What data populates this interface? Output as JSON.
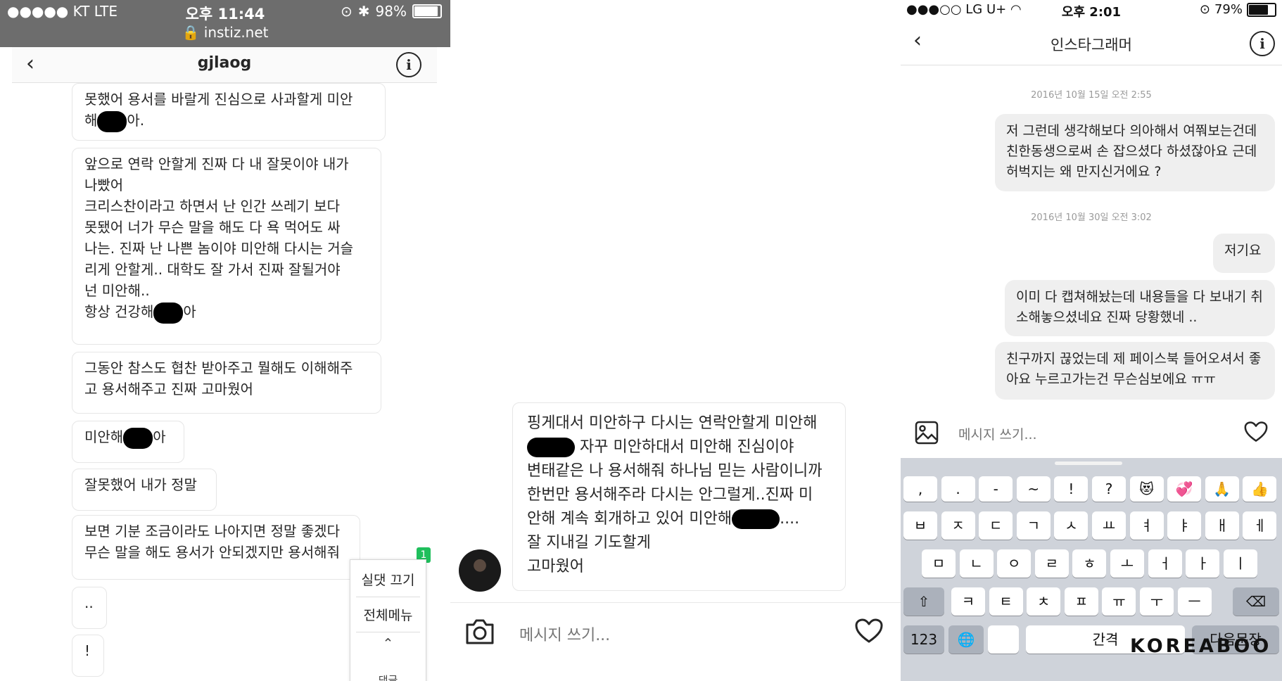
{
  "panel1": {
    "status": {
      "carrier": "●●●●● KT  LTE",
      "time": "오후 11:44",
      "battery": "98%",
      "battery_level": 0.98,
      "url": "instiz.net"
    },
    "header": {
      "title": "gjlaog"
    },
    "messages": [
      [
        "못했어 용서를 바랄게 진심으로 사과할게 미안",
        "해[redacted]아."
      ],
      [
        "앞으로 연락 안할게 진짜 다 내 잘못이야 내가",
        "나빴어",
        "크리스찬이라고 하면서 난 인간 쓰레기 보다",
        "못됐어 너가 무슨 말을 해도 다 욕 먹어도 싸",
        "나는. 진짜 난 나쁜 놈이야 미안해 다시는 거슬",
        "리게 안할게.. 대학도 잘 가서 진짜 잘될거야",
        "넌 미안해..",
        "항상 건강해[redacted]아"
      ],
      [
        "그동안 참스도 협찬 받아주고 뭘해도 이해해주",
        "고 용서해주고 진짜 고마웠어"
      ],
      [
        "미안해[redacted]아"
      ],
      [
        "잘못했어 내가 정말"
      ],
      [
        "보면 기분 조금이라도 나아지면 정말 좋겠다",
        "무슨 말을 해도 용서가 안되겠지만 용서해줘"
      ],
      [
        ".."
      ],
      [
        "!"
      ]
    ],
    "menu": {
      "badge": "1",
      "item1": "실댓 끄기",
      "item2": "전체메뉴",
      "item3": "댓글"
    }
  },
  "panel2": {
    "message": [
      "핑게대서 미안하구 다시는 연락안할게 미안해",
      "[redacted] 자꾸 미안하대서 미안해 진심이야",
      "변태같은 나 용서해줘 하나님 믿는 사람이니까",
      "한번만 용서해주라 다시는 안그럴게..진짜 미",
      "안해 계속 회개하고 있어 미안해[redacted]....",
      "잘 지내길 기도할게",
      "고마웠어"
    ],
    "composer": {
      "placeholder": "메시지 쓰기..."
    }
  },
  "panel3": {
    "status": {
      "carrier": "●●●○○ LG U+",
      "time": "오후 2:01",
      "battery": "79%",
      "battery_level": 0.79
    },
    "header": {
      "title": "인스타그래머"
    },
    "timestamps": [
      "2016년 10월 15일 오전 2:55",
      "2016년 10월 30일 오전 3:02"
    ],
    "messages": [
      [
        "저 그런데 생각해보다 의아해서 여쭤보는건데",
        "친한동생으로써 손 잡으셨다 하셨잖아요 근데",
        "허벅지는 왜 만지신거에요 ?"
      ],
      [
        "저기요"
      ],
      [
        "이미 다 캡쳐해놨는데 내용들을 다 보내기 취",
        "소해놓으셨네요 진짜 당황했네 .."
      ],
      [
        "친구까지 끊었는데 제 페이스북 들어오셔서 좋",
        "아요 누르고가는건 무슨심보에요 ㅠㅠ"
      ]
    ],
    "composer": {
      "placeholder": "메시지 쓰기..."
    },
    "keyboard": {
      "row0": [
        ",",
        ".",
        "-",
        "~",
        "!",
        "?",
        "😻",
        "💞",
        "🙏",
        "👍"
      ],
      "row1": [
        "ㅂ",
        "ㅈ",
        "ㄷ",
        "ㄱ",
        "ㅅ",
        "ㅛ",
        "ㅕ",
        "ㅑ",
        "ㅐ",
        "ㅔ"
      ],
      "row2": [
        "ㅁ",
        "ㄴ",
        "ㅇ",
        "ㄹ",
        "ㅎ",
        "ㅗ",
        "ㅓ",
        "ㅏ",
        "ㅣ"
      ],
      "row3": [
        "ㅋ",
        "ㅌ",
        "ㅊ",
        "ㅍ",
        "ㅠ",
        "ㅜ",
        "ㅡ"
      ],
      "numbers": "123",
      "space": "간격",
      "return": "다음문장"
    },
    "watermark": "KOREABOO"
  }
}
